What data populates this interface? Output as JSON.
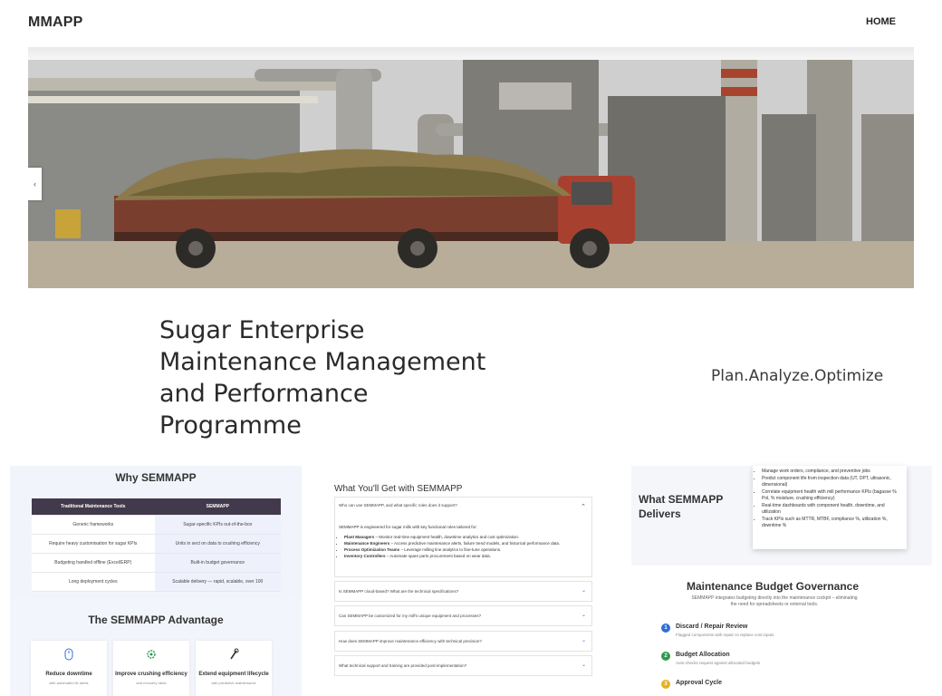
{
  "header": {
    "logo": "MMAPP",
    "nav_home": "HOME"
  },
  "hero": {
    "prev_icon": "chevron-left-icon"
  },
  "title": {
    "lines": [
      "Sugar Enterprise",
      "Maintenance Management",
      "and Performance",
      "Programme"
    ],
    "tagline": "Plan.Analyze.Optimize"
  },
  "why": {
    "heading": "Why SEMMAPP",
    "table": {
      "headers": [
        "Traditional Maintenance Tools",
        "SEMMAPP"
      ],
      "rows": [
        [
          "Generic frameworks",
          "Sugar-specific KPIs out-of-the-box"
        ],
        [
          "Require heavy customisation for sugar KPIs",
          "Units in sect on data to crushing efficiency"
        ],
        [
          "Budgeting handled offline (Excel/ERP)",
          "Built-in budget governance"
        ],
        [
          "Long deployment cycles",
          "Scalable delivery — rapid, scalable, over 100"
        ]
      ]
    }
  },
  "advantage": {
    "heading": "The SEMMAPP Advantage",
    "cards": [
      {
        "icon": "mouse-icon",
        "title": "Reduce downtime",
        "sub": "with automated fix alerts"
      },
      {
        "icon": "gear-icon",
        "title": "Improve crushing efficiency",
        "sub": "and recovery rates"
      },
      {
        "icon": "wrench-icon",
        "title": "Extend equipment lifecycle",
        "sub": "with predictive maintenance"
      }
    ]
  },
  "faq": {
    "heading": "What You'll Get with SEMMAPP",
    "open": {
      "question": "Who can use SEMMAPP, and what specific roles does it support?",
      "intro": "SEMMAPP is engineered for sugar mills with key functional roles tailored for:",
      "items": [
        {
          "role": "Plant Managers",
          "desc": " – Monitor real-time equipment health, downtime analytics and cost optimization."
        },
        {
          "role": "Maintenance Engineers",
          "desc": " – Access predictive maintenance alerts, failure trend models, and historical performance data."
        },
        {
          "role": "Process Optimization Teams",
          "desc": " – Leverage milling line analytics to fine-tune operations."
        },
        {
          "role": "Inventory Controllers",
          "desc": " – Automate spare parts procurement based on wear data."
        }
      ]
    },
    "items": [
      "Is SEMMAPP cloud-based? What are the technical specifications?",
      "Can SEMMAPP be customized for my mill's unique equipment and processes?",
      "How does SEMMAPP improve maintenance efficiency with technical precision?",
      "What technical support and training are provided post-implementation?"
    ]
  },
  "delivers": {
    "heading": "What SEMMAPP Delivers",
    "bullets": [
      "Manage work orders, compliance, and preventive jobs",
      "Predict component life from inspection data (UT, DPT, ultrasonic, dimensional)",
      "Correlate equipment health with mill performance KPIs (bagasse % Pol, % moisture, crushing efficiency)",
      "Real-time dashboards with component health, downtime, and utilization",
      "Track KPIs such as MTTR, MTBF, compliance %, utilization %, downtime %"
    ]
  },
  "budget": {
    "heading": "Maintenance Budget Governance",
    "desc": "SEMMAPP integrates budgeting directly into the maintenance cockpit – eliminating the need for spreadsheets or external tools.",
    "steps": [
      {
        "num": "1",
        "label": "Discard / Repair Review",
        "sub": "Flagged components with repair vs replace cost inputs",
        "color": "#2f6fd6"
      },
      {
        "num": "2",
        "label": "Budget Allocation",
        "sub": "Auto-checks request against allocated budgets",
        "color": "#2e9b4a"
      },
      {
        "num": "3",
        "label": "Approval Cycle",
        "sub": "",
        "color": "#e6b223"
      }
    ]
  }
}
